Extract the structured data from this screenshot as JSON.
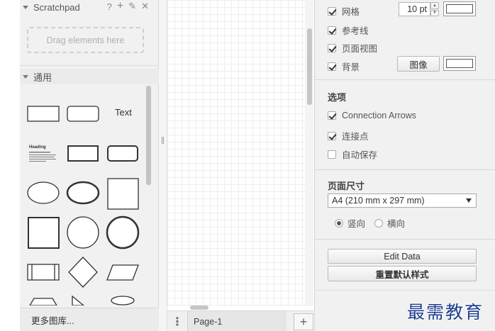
{
  "sidebar": {
    "scratchpad_title": "Scratchpad",
    "scratchpad_tools": {
      "help": "?",
      "add": "+",
      "edit": "✎",
      "close": "✕"
    },
    "dropzone_text": "Drag elements here",
    "general_title": "通用",
    "shapes_text_label": "Text",
    "shapes_heading_label": "Heading",
    "more_libraries": "更多图库..."
  },
  "page_tabs": {
    "menu_icon": "⋮",
    "current_page": "Page-1",
    "add_icon": "+"
  },
  "panel": {
    "view": {
      "grid_label": "网格",
      "grid_checked": true,
      "grid_size": "10 pt",
      "guides_label": "参考线",
      "guides_checked": true,
      "page_view_label": "页面视图",
      "page_view_checked": true,
      "background_label": "背景",
      "background_checked": true,
      "image_button": "图像"
    },
    "options": {
      "title": "选项",
      "connection_arrows_label": "Connection Arrows",
      "connection_arrows_checked": true,
      "connection_points_label": "连接点",
      "connection_points_checked": true,
      "autosave_label": "自动保存",
      "autosave_checked": false
    },
    "page_size": {
      "title": "页面尺寸",
      "selected": "A4 (210 mm x 297 mm)",
      "portrait_label": "竖向",
      "landscape_label": "横向",
      "orientation": "portrait"
    },
    "buttons": {
      "edit_data": "Edit Data",
      "reset_styles": "重置默认样式"
    }
  },
  "watermark": "最需教育"
}
